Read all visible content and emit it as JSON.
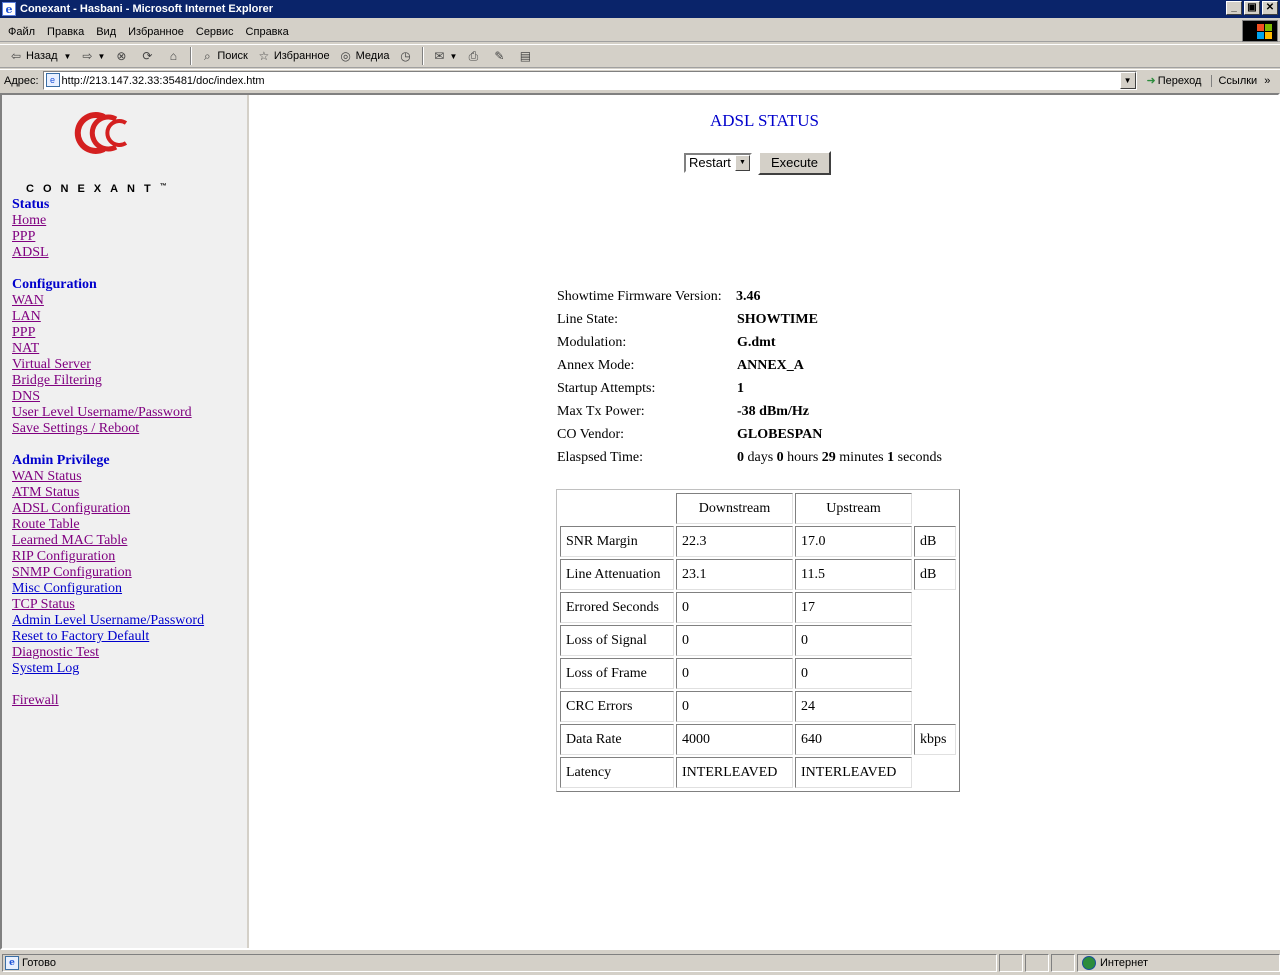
{
  "window": {
    "title": "Conexant - Hasbani - Microsoft Internet Explorer"
  },
  "menu": [
    "Файл",
    "Правка",
    "Вид",
    "Избранное",
    "Сервис",
    "Справка"
  ],
  "toolbar": {
    "back": "Назад",
    "search": "Поиск",
    "favorites": "Избранное",
    "media": "Медиа"
  },
  "address": {
    "label": "Адрес:",
    "url": "http://213.147.32.33:35481/doc/index.htm",
    "go": "Переход",
    "links": "Ссылки"
  },
  "logo": {
    "text": "CONEXANT",
    "tm": "™"
  },
  "sidebar": {
    "status_title": "Status",
    "status_links": [
      "Home",
      "PPP",
      "ADSL"
    ],
    "config_title": "Configuration",
    "config_links": [
      "WAN",
      "LAN",
      "PPP",
      "NAT",
      "Virtual Server",
      "Bridge Filtering",
      "DNS",
      "User Level Username/Password",
      "Save Settings / Reboot"
    ],
    "admin_title": "Admin Privilege",
    "admin_links": [
      "WAN Status",
      "ATM Status",
      "ADSL Configuration",
      "Route Table",
      "Learned MAC Table",
      "RIP Configuration",
      "SNMP Configuration",
      "Misc Configuration",
      "TCP Status",
      "Admin Level Username/Password",
      "Reset to Factory Default",
      "Diagnostic Test",
      "System Log"
    ],
    "firewall": "Firewall"
  },
  "main": {
    "title": "ADSL STATUS",
    "action_select": "Restart",
    "execute": "Execute",
    "info": [
      {
        "label": "Showtime Firmware Version:",
        "value": "3.46"
      },
      {
        "label": "Line State:",
        "value": "SHOWTIME"
      },
      {
        "label": "Modulation:",
        "value": "G.dmt"
      },
      {
        "label": "Annex Mode:",
        "value": "ANNEX_A"
      },
      {
        "label": "Startup Attempts:",
        "value": "1"
      },
      {
        "label": "Max Tx Power:",
        "value": "-38 dBm/Hz"
      },
      {
        "label": "CO Vendor:",
        "value": "GLOBESPAN"
      }
    ],
    "elapsed": {
      "label": "Elaspsed Time:",
      "days": "0",
      "days_label": "days",
      "hours": "0",
      "hours_label": "hours",
      "minutes": "29",
      "minutes_label": "minutes",
      "seconds": "1",
      "seconds_label": "seconds"
    },
    "table": {
      "headers": [
        "Downstream",
        "Upstream"
      ],
      "rows": [
        {
          "name": "SNR Margin",
          "down": "22.3",
          "up": "17.0",
          "unit": "dB"
        },
        {
          "name": "Line Attenuation",
          "down": "23.1",
          "up": "11.5",
          "unit": "dB"
        },
        {
          "name": "Errored Seconds",
          "down": "0",
          "up": "17",
          "unit": ""
        },
        {
          "name": "Loss of Signal",
          "down": "0",
          "up": "0",
          "unit": ""
        },
        {
          "name": "Loss of Frame",
          "down": "0",
          "up": "0",
          "unit": ""
        },
        {
          "name": "CRC Errors",
          "down": "0",
          "up": "24",
          "unit": ""
        },
        {
          "name": "Data Rate",
          "down": "4000",
          "up": "640",
          "unit": "kbps"
        },
        {
          "name": "Latency",
          "down": "INTERLEAVED",
          "up": "INTERLEAVED",
          "unit": ""
        }
      ]
    }
  },
  "statusbar": {
    "text": "Готово",
    "zone": "Интернет"
  }
}
